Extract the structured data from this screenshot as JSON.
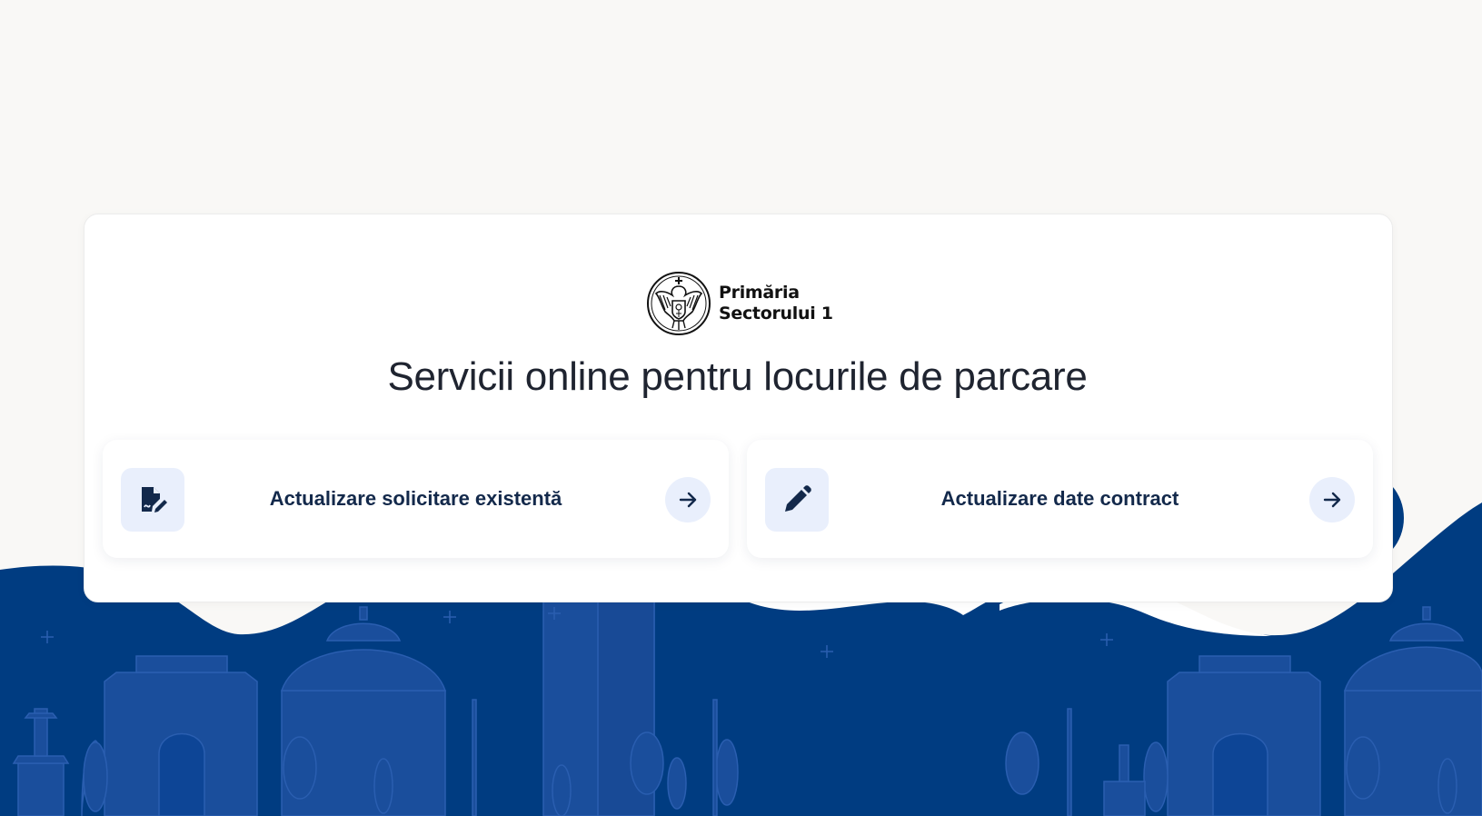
{
  "colors": {
    "background": "#f9f8f6",
    "brand_blue": "#003c81",
    "silhouette_blue": "#1a4e9c",
    "card": "#ffffff",
    "icon_tile": "#e9effc",
    "text_dark": "#13294b"
  },
  "logo": {
    "icon": "coat-of-arms-icon",
    "line1": "Primăria",
    "line2": "Sectorului 1"
  },
  "page": {
    "title": "Servicii online pentru locurile de parcare"
  },
  "options": [
    {
      "icon": "file-signature-icon",
      "label": "Actualizare solicitare existentă",
      "arrow_icon": "arrow-right-icon"
    },
    {
      "icon": "pencil-icon",
      "label": "Actualizare date contract",
      "arrow_icon": "arrow-right-icon"
    }
  ]
}
